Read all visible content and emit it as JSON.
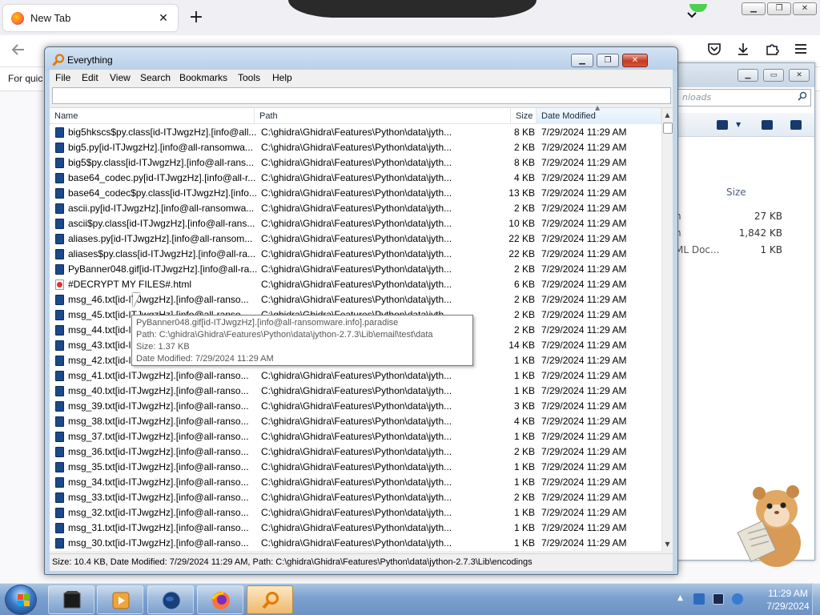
{
  "browser": {
    "tab_title": "New Tab",
    "tab_close": "✕",
    "new_tab": "+",
    "list_tabs": "⌄",
    "bookmarks_text": "For quic"
  },
  "explorer": {
    "search_placeholder": "nloads",
    "size_header": "Size",
    "rows": [
      {
        "type": "n",
        "size": "27 KB"
      },
      {
        "type": "n",
        "size": "1,842 KB"
      },
      {
        "type": "ML Doc...",
        "size": "1 KB"
      }
    ]
  },
  "everything": {
    "title": "Everything",
    "menu": [
      "File",
      "Edit",
      "View",
      "Search",
      "Bookmarks",
      "Tools",
      "Help"
    ],
    "search_value": "",
    "columns": {
      "name": "Name",
      "path": "Path",
      "size": "Size",
      "date": "Date Modified"
    },
    "rows": [
      {
        "name": "big5hkscs$py.class[id-ITJwgzHz].[info@all...",
        "path": "C:\\ghidra\\Ghidra\\Features\\Python\\data\\jyth...",
        "size": "8 KB",
        "date": "7/29/2024 11:29 AM",
        "icon": "file"
      },
      {
        "name": "big5.py[id-ITJwgzHz].[info@all-ransomwa...",
        "path": "C:\\ghidra\\Ghidra\\Features\\Python\\data\\jyth...",
        "size": "2 KB",
        "date": "7/29/2024 11:29 AM",
        "icon": "file"
      },
      {
        "name": "big5$py.class[id-ITJwgzHz].[info@all-rans...",
        "path": "C:\\ghidra\\Ghidra\\Features\\Python\\data\\jyth...",
        "size": "8 KB",
        "date": "7/29/2024 11:29 AM",
        "icon": "file"
      },
      {
        "name": "base64_codec.py[id-ITJwgzHz].[info@all-r...",
        "path": "C:\\ghidra\\Ghidra\\Features\\Python\\data\\jyth...",
        "size": "4 KB",
        "date": "7/29/2024 11:29 AM",
        "icon": "file"
      },
      {
        "name": "base64_codec$py.class[id-ITJwgzHz].[info...",
        "path": "C:\\ghidra\\Ghidra\\Features\\Python\\data\\jyth...",
        "size": "13 KB",
        "date": "7/29/2024 11:29 AM",
        "icon": "file"
      },
      {
        "name": "ascii.py[id-ITJwgzHz].[info@all-ransomwa...",
        "path": "C:\\ghidra\\Ghidra\\Features\\Python\\data\\jyth...",
        "size": "2 KB",
        "date": "7/29/2024 11:29 AM",
        "icon": "file"
      },
      {
        "name": "ascii$py.class[id-ITJwgzHz].[info@all-rans...",
        "path": "C:\\ghidra\\Ghidra\\Features\\Python\\data\\jyth...",
        "size": "10 KB",
        "date": "7/29/2024 11:29 AM",
        "icon": "file"
      },
      {
        "name": "aliases.py[id-ITJwgzHz].[info@all-ransom...",
        "path": "C:\\ghidra\\Ghidra\\Features\\Python\\data\\jyth...",
        "size": "22 KB",
        "date": "7/29/2024 11:29 AM",
        "icon": "file"
      },
      {
        "name": "aliases$py.class[id-ITJwgzHz].[info@all-ra...",
        "path": "C:\\ghidra\\Ghidra\\Features\\Python\\data\\jyth...",
        "size": "22 KB",
        "date": "7/29/2024 11:29 AM",
        "icon": "file"
      },
      {
        "name": "PyBanner048.gif[id-ITJwgzHz].[info@all-ra...",
        "path": "C:\\ghidra\\Ghidra\\Features\\Python\\data\\jyth...",
        "size": "2 KB",
        "date": "7/29/2024 11:29 AM",
        "icon": "file"
      },
      {
        "name": "#DECRYPT MY FILES#.html",
        "path": "C:\\ghidra\\Ghidra\\Features\\Python\\data\\jyth...",
        "size": "6 KB",
        "date": "7/29/2024 11:29 AM",
        "icon": "html"
      },
      {
        "name": "msg_46.txt[id-ITJwgzHz].[info@all-ranso...",
        "path": "C:\\ghidra\\Ghidra\\Features\\Python\\data\\jyth...",
        "size": "2 KB",
        "date": "7/29/2024 11:29 AM",
        "icon": "file"
      },
      {
        "name": "msg_45.txt[id-ITJwgzHz].[info@all-ranso...",
        "path": "C:\\ghidra\\Ghidra\\Features\\Python\\data\\jyth...",
        "size": "2 KB",
        "date": "7/29/2024 11:29 AM",
        "icon": "file"
      },
      {
        "name": "msg_44.txt[id-ITJwgzHz].[info@all-ranso...",
        "path": "C:\\ghidra\\Ghidra\\Features\\Python\\data\\jyth...",
        "size": "2 KB",
        "date": "7/29/2024 11:29 AM",
        "icon": "file"
      },
      {
        "name": "msg_43.txt[id-ITJwgzHz].[info@all-ranso...",
        "path": "C:\\ghidra\\Ghidra\\Features\\Python\\data\\jyth...",
        "size": "14 KB",
        "date": "7/29/2024 11:29 AM",
        "icon": "file"
      },
      {
        "name": "msg_42.txt[id-ITJwgzHz].[info@all-ranso...",
        "path": "C:\\ghidra\\Ghidra\\Features\\Python\\data\\jyth...",
        "size": "1 KB",
        "date": "7/29/2024 11:29 AM",
        "icon": "file"
      },
      {
        "name": "msg_41.txt[id-ITJwgzHz].[info@all-ranso...",
        "path": "C:\\ghidra\\Ghidra\\Features\\Python\\data\\jyth...",
        "size": "1 KB",
        "date": "7/29/2024 11:29 AM",
        "icon": "file"
      },
      {
        "name": "msg_40.txt[id-ITJwgzHz].[info@all-ranso...",
        "path": "C:\\ghidra\\Ghidra\\Features\\Python\\data\\jyth...",
        "size": "1 KB",
        "date": "7/29/2024 11:29 AM",
        "icon": "file"
      },
      {
        "name": "msg_39.txt[id-ITJwgzHz].[info@all-ranso...",
        "path": "C:\\ghidra\\Ghidra\\Features\\Python\\data\\jyth...",
        "size": "3 KB",
        "date": "7/29/2024 11:29 AM",
        "icon": "file"
      },
      {
        "name": "msg_38.txt[id-ITJwgzHz].[info@all-ranso...",
        "path": "C:\\ghidra\\Ghidra\\Features\\Python\\data\\jyth...",
        "size": "4 KB",
        "date": "7/29/2024 11:29 AM",
        "icon": "file"
      },
      {
        "name": "msg_37.txt[id-ITJwgzHz].[info@all-ranso...",
        "path": "C:\\ghidra\\Ghidra\\Features\\Python\\data\\jyth...",
        "size": "1 KB",
        "date": "7/29/2024 11:29 AM",
        "icon": "file"
      },
      {
        "name": "msg_36.txt[id-ITJwgzHz].[info@all-ranso...",
        "path": "C:\\ghidra\\Ghidra\\Features\\Python\\data\\jyth...",
        "size": "2 KB",
        "date": "7/29/2024 11:29 AM",
        "icon": "file"
      },
      {
        "name": "msg_35.txt[id-ITJwgzHz].[info@all-ranso...",
        "path": "C:\\ghidra\\Ghidra\\Features\\Python\\data\\jyth...",
        "size": "1 KB",
        "date": "7/29/2024 11:29 AM",
        "icon": "file"
      },
      {
        "name": "msg_34.txt[id-ITJwgzHz].[info@all-ranso...",
        "path": "C:\\ghidra\\Ghidra\\Features\\Python\\data\\jyth...",
        "size": "1 KB",
        "date": "7/29/2024 11:29 AM",
        "icon": "file"
      },
      {
        "name": "msg_33.txt[id-ITJwgzHz].[info@all-ranso...",
        "path": "C:\\ghidra\\Ghidra\\Features\\Python\\data\\jyth...",
        "size": "2 KB",
        "date": "7/29/2024 11:29 AM",
        "icon": "file"
      },
      {
        "name": "msg_32.txt[id-ITJwgzHz].[info@all-ranso...",
        "path": "C:\\ghidra\\Ghidra\\Features\\Python\\data\\jyth...",
        "size": "1 KB",
        "date": "7/29/2024 11:29 AM",
        "icon": "file"
      },
      {
        "name": "msg_31.txt[id-ITJwgzHz].[info@all-ranso...",
        "path": "C:\\ghidra\\Ghidra\\Features\\Python\\data\\jyth...",
        "size": "1 KB",
        "date": "7/29/2024 11:29 AM",
        "icon": "file"
      },
      {
        "name": "msg_30.txt[id-ITJwgzHz].[info@all-ranso...",
        "path": "C:\\ghidra\\Ghidra\\Features\\Python\\data\\jyth...",
        "size": "1 KB",
        "date": "7/29/2024 11:29 AM",
        "icon": "file"
      }
    ],
    "tooltip": {
      "name": "PyBanner048.gif[id-ITJwgzHz].[info@all-ransomware.info].paradise",
      "path": "Path: C:\\ghidra\\Ghidra\\Features\\Python\\data\\jython-2.7.3\\Lib\\email\\test\\data",
      "size": "Size: 1.37 KB",
      "date": "Date Modified: 7/29/2024 11:29 AM"
    },
    "status": "Size: 10.4 KB, Date Modified: 7/29/2024 11:29 AM, Path: C:\\ghidra\\Ghidra\\Features\\Python\\data\\jython-2.7.3\\Lib\\encodings"
  },
  "taskbar": {
    "time": "11:29 AM",
    "date": "7/29/2024"
  },
  "colors": {
    "accent_orange": "#e07c00",
    "file_icon_blue": "#1b4a8a",
    "close_red": "#c43a22",
    "taskbar_blue": "#7aa0cf"
  }
}
